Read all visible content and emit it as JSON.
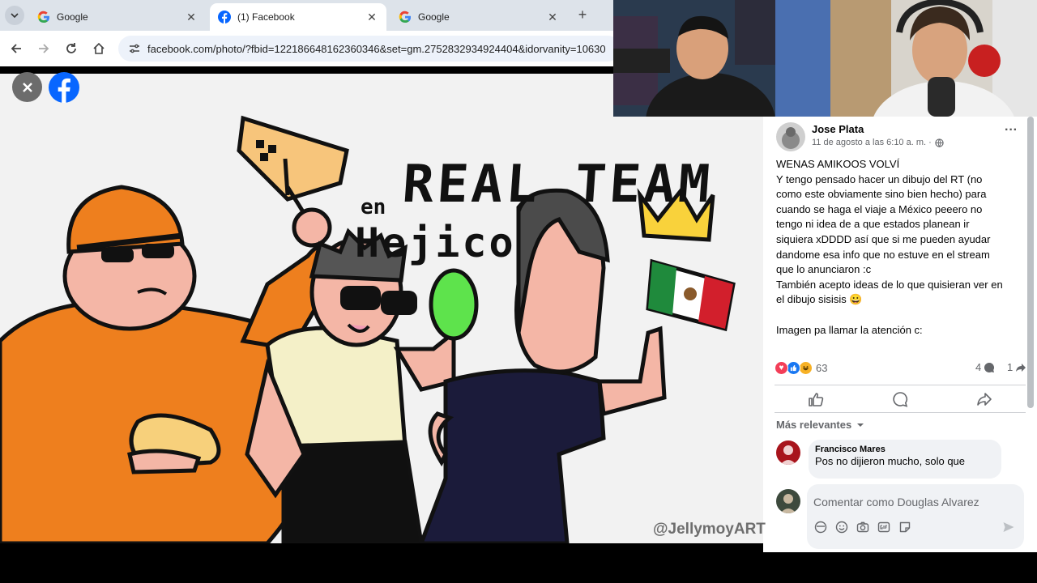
{
  "browser": {
    "tabs": [
      {
        "title": "Google",
        "icon": "google-icon",
        "active": false
      },
      {
        "title": "(1) Facebook",
        "icon": "facebook-icon",
        "active": true
      },
      {
        "title": "Google",
        "icon": "google-icon",
        "active": false
      }
    ],
    "close_glyph": "✕",
    "new_tab_glyph": "+",
    "url": "facebook.com/photo/?fbid=122186648162360346&set=gm.2752832934924404&idorvanity=10630"
  },
  "photo": {
    "drawing_title": "REAL TEAM",
    "drawing_sub_en": "en",
    "drawing_sub": "Hejico",
    "watermark": "@JellymoyART"
  },
  "post": {
    "author": "Jose Plata",
    "timestamp": "11 de agosto a las 6:10 a. m. ·",
    "more_glyph": "···",
    "lines": [
      "WENAS AMIKOOS VOLVÍ",
      "Y tengo pensado hacer un dibujo del RT (no",
      "como este obviamente sino bien hecho) para",
      "cuando se haga el viaje a México peeero no",
      "tengo ni idea de a que estados planean ir",
      "siquiera xDDDD así que si me pueden ayudar",
      "dandome esa info que no estuve en el stream",
      "que lo anunciaron :c",
      "También acepto ideas de lo que quisieran ver en",
      "el dibujo sisisis 😀",
      "",
      "Imagen pa llamar la atención c:"
    ],
    "reaction_count": "63",
    "comment_count": "4",
    "share_count": "1"
  },
  "comments": {
    "sort_label": "Más relevantes",
    "items": [
      {
        "author": "Francisco Mares",
        "text": "Pos no dijieron mucho, solo que"
      }
    ],
    "input_placeholder": "Comentar como Douglas Alvarez"
  },
  "colors": {
    "facebook_blue": "#0866ff",
    "like_blue": "#1877f2",
    "love_red": "#f33e58",
    "haha_yellow": "#f7b125"
  }
}
